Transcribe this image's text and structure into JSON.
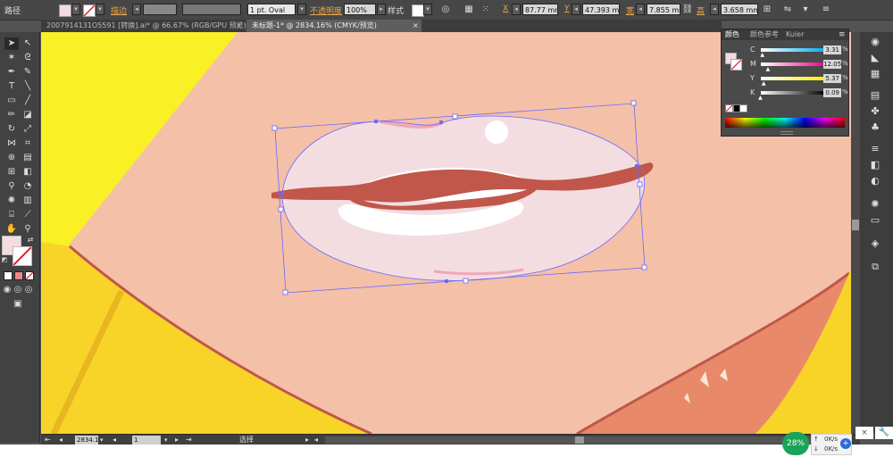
{
  "control_bar": {
    "path_label": "路径",
    "stroke_label": "描边",
    "brush_value": "1 pt. Oval",
    "opacity_label": "不透明度",
    "opacity_value": "100%",
    "style_label": "样式",
    "x_label": "X",
    "x_value": "87.77 mm",
    "y_label": "Y",
    "y_value": "47.393 mm",
    "w_label": "宽",
    "w_value": "7.855 mm",
    "h_label": "高",
    "h_value": "3.658 mm"
  },
  "tabs": [
    {
      "label": "2007914131O5591 [转换].ai* @ 66.67% (RGB/GPU 预览)",
      "close": "×"
    },
    {
      "label": "未标题-1* @ 2834.16% (CMYK/预览)",
      "close": "×"
    }
  ],
  "color_panel": {
    "tabs": [
      "颜色",
      "颜色参考",
      "Kuler"
    ],
    "channels": [
      {
        "label": "C",
        "value": "3.31",
        "unit": "%",
        "fraction": 0.0331
      },
      {
        "label": "M",
        "value": "12.05",
        "unit": "%",
        "fraction": 0.1205
      },
      {
        "label": "Y",
        "value": "5.37",
        "unit": "%",
        "fraction": 0.0537
      },
      {
        "label": "K",
        "value": "0.09",
        "unit": "%",
        "fraction": 0.0009
      }
    ]
  },
  "status_bar": {
    "zoom": "2834.1",
    "page": "1",
    "tool": "选择"
  },
  "net_widget": {
    "percent": "28%",
    "up": "0K/s",
    "down": "0K/s"
  },
  "colors": {
    "fill": "#f3dde0",
    "skin": "#f4c0a8",
    "yellow": "#f9f026",
    "lip_line": "#c0574a",
    "selection": "#6a6aff",
    "neck": "#e88a6a",
    "net_green": "#1aa35a"
  }
}
